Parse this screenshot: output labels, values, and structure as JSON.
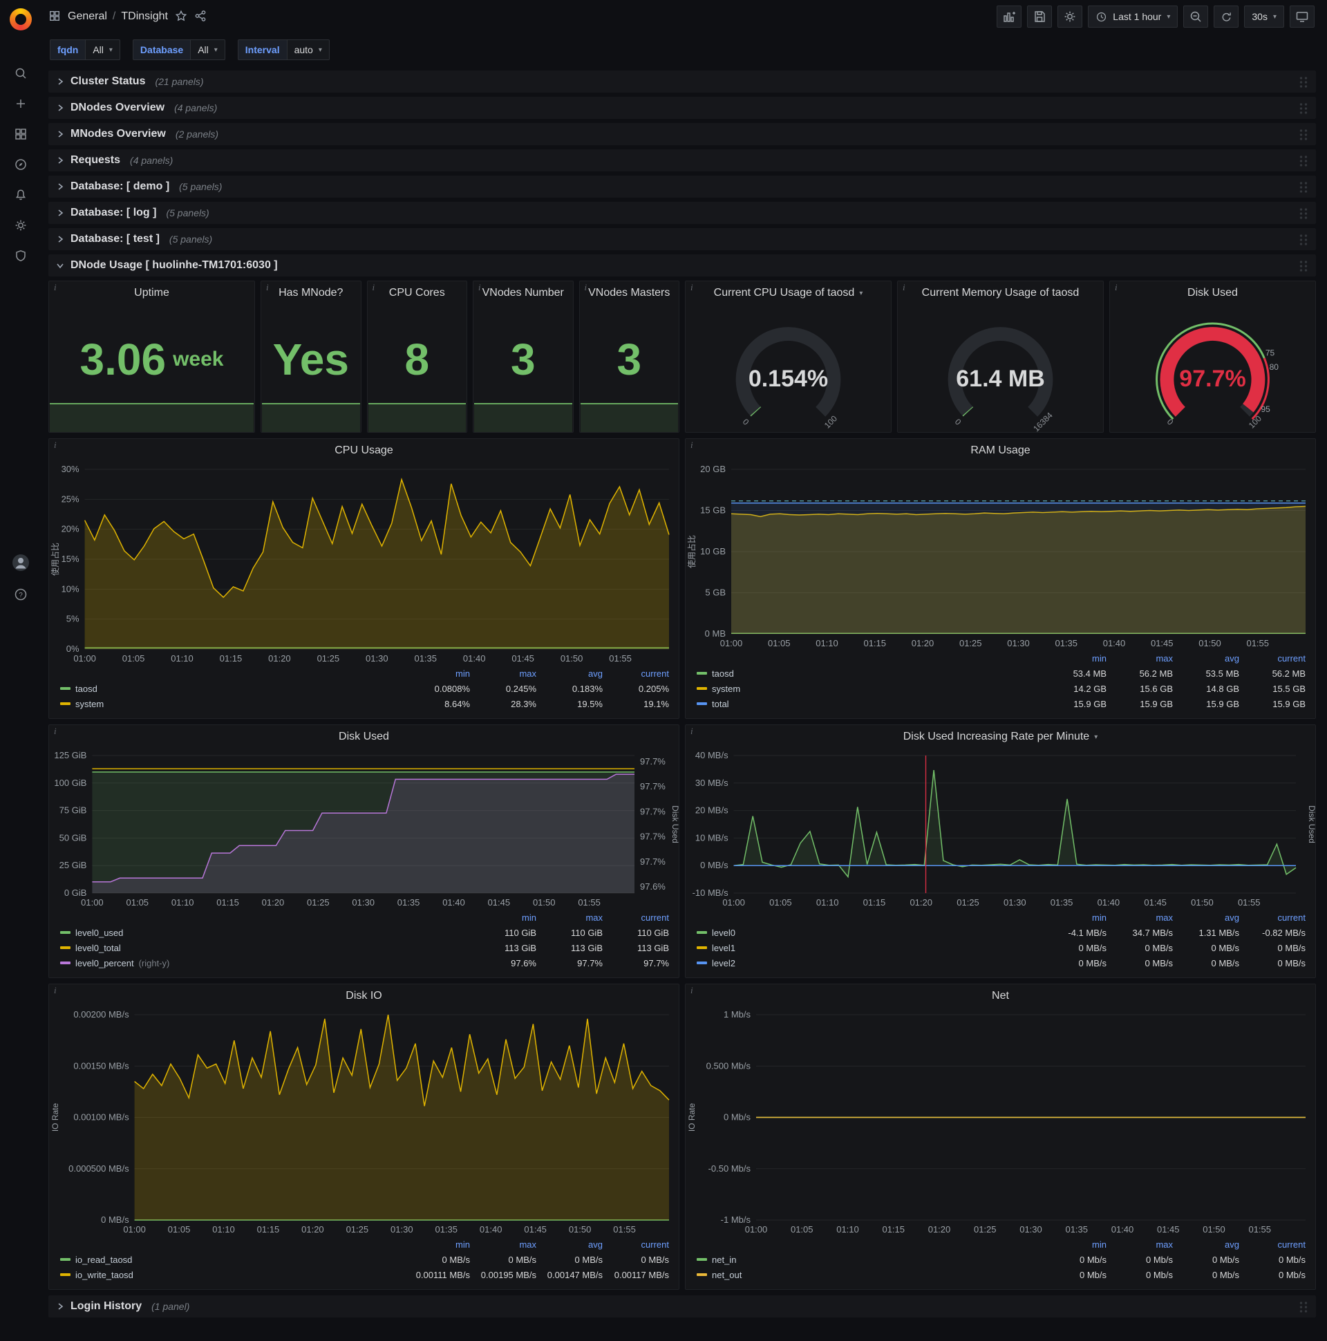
{
  "colors": {
    "green": "#73bf69",
    "yellow": "#e0b400",
    "blue": "#5794f2",
    "purple": "#b877d9",
    "red": "#e02f44",
    "orange": "#eab839",
    "cyan": "#6ed0e0"
  },
  "topnav": {
    "breadcrumb": {
      "section": "General",
      "separator": "/",
      "title": "TDinsight"
    },
    "time_range": "Last 1 hour",
    "refresh": "30s"
  },
  "variables": [
    {
      "label": "fqdn",
      "value": "All"
    },
    {
      "label": "Database",
      "value": "All"
    },
    {
      "label": "Interval",
      "value": "auto"
    }
  ],
  "rows_top": [
    {
      "title": "Cluster Status",
      "count": "(21 panels)"
    },
    {
      "title": "DNodes Overview",
      "count": "(4 panels)"
    },
    {
      "title": "MNodes Overview",
      "count": "(2 panels)"
    },
    {
      "title": "Requests",
      "count": "(4 panels)"
    },
    {
      "title": "Database: [ demo ]",
      "count": "(5 panels)"
    },
    {
      "title": "Database: [ log ]",
      "count": "(5 panels)"
    },
    {
      "title": "Database: [ test ]",
      "count": "(5 panels)"
    }
  ],
  "dnode_row": {
    "title": "DNode Usage [ huolinhe-TM1701:6030 ]"
  },
  "bottom_row": {
    "title": "Login History",
    "count": "(1 panel)"
  },
  "stats": [
    {
      "title": "Uptime",
      "value": "3.06",
      "suffix": "week"
    },
    {
      "title": "Has MNode?",
      "value": "Yes",
      "suffix": ""
    },
    {
      "title": "CPU Cores",
      "value": "8",
      "suffix": ""
    },
    {
      "title": "VNodes Number",
      "value": "3",
      "suffix": ""
    },
    {
      "title": "VNodes Masters",
      "value": "3",
      "suffix": ""
    }
  ],
  "gauges": [
    {
      "title": "Current CPU Usage of taosd",
      "caret": true,
      "value": "0.154%",
      "value_color": "#d8d9da",
      "fraction": 0.00154,
      "arc_color": "#73bf69",
      "min_label": "0",
      "max_label": "100"
    },
    {
      "title": "Current Memory Usage of taosd",
      "caret": false,
      "value": "61.4 MB",
      "value_color": "#d8d9da",
      "fraction": 0.0037,
      "arc_color": "#73bf69",
      "min_label": "0",
      "max_label": "16384"
    },
    {
      "title": "Disk Used",
      "caret": false,
      "value": "97.7%",
      "value_color": "#e02f44",
      "fraction": 0.977,
      "arc_color": "#e02f44",
      "min_label": "0",
      "max_label": "100",
      "ring": [
        {
          "from": 0,
          "to": 0.75,
          "color": "#73bf69"
        },
        {
          "from": 0.75,
          "to": 1,
          "color": "#e02f44"
        }
      ],
      "thresholds": [
        {
          "f": 0.75,
          "label": "75"
        },
        {
          "f": 0.8,
          "label": "80"
        },
        {
          "f": 0.95,
          "label": "95"
        }
      ]
    }
  ],
  "time_axis": {
    "minutes": 60,
    "step": 5,
    "ticks": [
      "01:00",
      "01:05",
      "01:10",
      "01:15",
      "01:20",
      "01:25",
      "01:30",
      "01:35",
      "01:40",
      "01:45",
      "01:50",
      "01:55"
    ]
  },
  "chart_data": [
    {
      "type": "line",
      "title": "CPU Usage",
      "ylabel": "使用占比",
      "ylim": [
        0,
        30
      ],
      "yticks": [
        {
          "v": 0,
          "label": "0%"
        },
        {
          "v": 5,
          "label": "5%"
        },
        {
          "v": 10,
          "label": "10%"
        },
        {
          "v": 15,
          "label": "15%"
        },
        {
          "v": 20,
          "label": "20%"
        },
        {
          "v": 25,
          "label": "25%"
        },
        {
          "v": 30,
          "label": "30%"
        }
      ],
      "series": [
        {
          "name": "taosd",
          "color": "#73bf69",
          "const": 0.2,
          "fill": 0.12
        },
        {
          "name": "system",
          "color": "#e0b400",
          "fill": 0.22,
          "values": [
            21.5,
            18.2,
            22.4,
            19.8,
            16.4,
            14.9,
            17.2,
            20.1,
            21.3,
            19.6,
            18.4,
            19.2,
            14.8,
            10.2,
            8.64,
            10.4,
            9.7,
            13.5,
            16.2,
            24.6,
            20.3,
            17.8,
            16.9,
            25.2,
            21.4,
            17.6,
            23.8,
            19.3,
            24.2,
            20.6,
            17.2,
            21.0,
            28.3,
            23.6,
            18.1,
            21.4,
            15.8,
            27.6,
            22.3,
            18.7,
            21.2,
            19.4,
            23.1,
            17.8,
            16.2,
            13.9,
            18.6,
            23.4,
            20.2,
            25.8,
            17.3,
            21.6,
            19.2,
            24.3,
            27.1,
            22.4,
            26.6,
            20.8,
            24.4,
            19.1
          ]
        }
      ],
      "legend": {
        "cols": [
          "min",
          "max",
          "avg",
          "current"
        ],
        "rows": [
          {
            "name": "taosd",
            "color": "#73bf69",
            "vals": [
              "0.0808%",
              "0.245%",
              "0.183%",
              "0.205%"
            ]
          },
          {
            "name": "system",
            "color": "#e0b400",
            "vals": [
              "8.64%",
              "28.3%",
              "19.5%",
              "19.1%"
            ]
          }
        ]
      }
    },
    {
      "type": "line",
      "title": "RAM Usage",
      "ylabel": "使用占比",
      "ylim": [
        0,
        20
      ],
      "yticks": [
        {
          "v": 0,
          "label": "0 MB"
        },
        {
          "v": 5,
          "label": "5 GB"
        },
        {
          "v": 10,
          "label": "10 GB"
        },
        {
          "v": 15,
          "label": "15 GB"
        },
        {
          "v": 20,
          "label": "20 GB"
        }
      ],
      "series": [
        {
          "name": "taosd",
          "color": "#73bf69",
          "const": 0.055,
          "fill": 0.12
        },
        {
          "name": "system",
          "color": "#e0b400",
          "fill": 0.22,
          "values": [
            14.6,
            14.55,
            14.5,
            14.25,
            14.55,
            14.6,
            14.5,
            14.45,
            14.5,
            14.55,
            14.5,
            14.6,
            14.55,
            14.5,
            14.6,
            14.65,
            14.6,
            14.55,
            14.6,
            14.5,
            14.55,
            14.6,
            14.65,
            14.6,
            14.55,
            14.6,
            14.7,
            14.65,
            14.6,
            14.7,
            14.75,
            14.8,
            14.75,
            14.8,
            14.85,
            14.8,
            14.85,
            14.9,
            14.85,
            14.9,
            14.95,
            14.9,
            14.95,
            15.0,
            14.95,
            15.0,
            15.05,
            15.0,
            15.05,
            15.1,
            15.05,
            15.1,
            15.15,
            15.1,
            15.2,
            15.25,
            15.3,
            15.35,
            15.45,
            15.5
          ]
        },
        {
          "name": "total",
          "color": "#5794f2",
          "const": 15.9,
          "fill": 0.1
        },
        {
          "name": "",
          "color": "#6ed0e0",
          "const": 16.15,
          "dash": true,
          "width": 1
        }
      ],
      "legend": {
        "cols": [
          "min",
          "max",
          "avg",
          "current"
        ],
        "rows": [
          {
            "name": "taosd",
            "color": "#73bf69",
            "vals": [
              "53.4 MB",
              "56.2 MB",
              "53.5 MB",
              "56.2 MB"
            ]
          },
          {
            "name": "system",
            "color": "#e0b400",
            "vals": [
              "14.2 GB",
              "15.6 GB",
              "14.8 GB",
              "15.5 GB"
            ]
          },
          {
            "name": "total",
            "color": "#5794f2",
            "vals": [
              "15.9 GB",
              "15.9 GB",
              "15.9 GB",
              "15.9 GB"
            ]
          }
        ]
      }
    },
    {
      "type": "line",
      "title": "Disk Used",
      "ylim": [
        0,
        125
      ],
      "yticks": [
        {
          "v": 0,
          "label": "0 GiB"
        },
        {
          "v": 25,
          "label": "25 GiB"
        },
        {
          "v": 50,
          "label": "50 GiB"
        },
        {
          "v": 75,
          "label": "75 GiB"
        },
        {
          "v": 100,
          "label": "100 GiB"
        },
        {
          "v": 125,
          "label": "125 GiB"
        }
      ],
      "right": {
        "label": "Disk Used",
        "ylim": [
          97.595,
          97.705
        ],
        "ticks": [
          {
            "v": 97.6,
            "label": "97.6%"
          },
          {
            "v": 97.62,
            "label": "97.7%"
          },
          {
            "v": 97.64,
            "label": "97.7%"
          },
          {
            "v": 97.66,
            "label": "97.7%"
          },
          {
            "v": 97.68,
            "label": "97.7%"
          },
          {
            "v": 97.7,
            "label": "97.7%"
          }
        ]
      },
      "series": [
        {
          "name": "level0_used",
          "color": "#73bf69",
          "const": 110,
          "fill": 0.15
        },
        {
          "name": "level0_total",
          "color": "#e0b400",
          "const": 113
        },
        {
          "name": "level0_percent",
          "color": "#b877d9",
          "axis": "right",
          "fill": 0.15,
          "values": [
            97.604,
            97.604,
            97.604,
            97.607,
            97.607,
            97.607,
            97.607,
            97.607,
            97.607,
            97.607,
            97.607,
            97.607,
            97.607,
            97.627,
            97.627,
            97.627,
            97.633,
            97.633,
            97.633,
            97.633,
            97.633,
            97.645,
            97.645,
            97.645,
            97.645,
            97.659,
            97.659,
            97.659,
            97.659,
            97.659,
            97.659,
            97.659,
            97.659,
            97.686,
            97.686,
            97.686,
            97.686,
            97.686,
            97.686,
            97.686,
            97.686,
            97.686,
            97.686,
            97.686,
            97.686,
            97.686,
            97.686,
            97.686,
            97.686,
            97.686,
            97.686,
            97.686,
            97.686,
            97.686,
            97.686,
            97.686,
            97.686,
            97.69,
            97.69,
            97.69
          ]
        }
      ],
      "legend": {
        "cols": [
          "min",
          "max",
          "current"
        ],
        "rows": [
          {
            "name": "level0_used",
            "color": "#73bf69",
            "vals": [
              "110 GiB",
              "110 GiB",
              "110 GiB"
            ]
          },
          {
            "name": "level0_total",
            "color": "#e0b400",
            "vals": [
              "113 GiB",
              "113 GiB",
              "113 GiB"
            ]
          },
          {
            "name": "level0_percent",
            "color": "#b877d9",
            "note": "(right-y)",
            "vals": [
              "97.6%",
              "97.7%",
              "97.7%"
            ]
          }
        ]
      }
    },
    {
      "type": "line",
      "title": "Disk Used Increasing Rate per Minute",
      "title_caret": true,
      "ylim": [
        -10,
        40
      ],
      "yticks": [
        {
          "v": -10,
          "label": "-10 MB/s"
        },
        {
          "v": 0,
          "label": "0 MB/s"
        },
        {
          "v": 10,
          "label": "10 MB/s"
        },
        {
          "v": 20,
          "label": "20 MB/s"
        },
        {
          "v": 30,
          "label": "30 MB/s"
        },
        {
          "v": 40,
          "label": "40 MB/s"
        }
      ],
      "right": {
        "label": "Disk Used"
      },
      "vline": {
        "m": 20.5,
        "color": "#e02f44"
      },
      "series": [
        {
          "name": "level0",
          "color": "#73bf69",
          "fill": 0.12,
          "values": [
            0,
            0.4,
            18,
            1.2,
            0.2,
            -0.6,
            0.3,
            8.2,
            12.4,
            0.6,
            0.1,
            0.2,
            -4.1,
            21.3,
            0.4,
            12.1,
            0.3,
            0.1,
            0.2,
            0.4,
            0.1,
            34.7,
            1.8,
            0.3,
            -0.4,
            0.2,
            0.1,
            0.3,
            0.5,
            0.2,
            2.1,
            0.3,
            0.1,
            0.4,
            0.2,
            24.2,
            0.5,
            0.1,
            0.3,
            0.2,
            0.1,
            0.4,
            0.2,
            0.3,
            0.1,
            0.2,
            0.4,
            0.1,
            0.3,
            0.2,
            0.1,
            0.3,
            0.2,
            0.4,
            0.1,
            0.2,
            0.3,
            7.8,
            -3.2,
            -0.8
          ]
        },
        {
          "name": "level1",
          "color": "#e0b400",
          "const": 0
        },
        {
          "name": "level2",
          "color": "#5794f2",
          "const": 0
        }
      ],
      "legend": {
        "cols": [
          "min",
          "max",
          "avg",
          "current"
        ],
        "rows": [
          {
            "name": "level0",
            "color": "#73bf69",
            "vals": [
              "-4.1 MB/s",
              "34.7 MB/s",
              "1.31 MB/s",
              "-0.82 MB/s"
            ]
          },
          {
            "name": "level1",
            "color": "#e0b400",
            "vals": [
              "0 MB/s",
              "0 MB/s",
              "0 MB/s",
              "0 MB/s"
            ]
          },
          {
            "name": "level2",
            "color": "#5794f2",
            "vals": [
              "0 MB/s",
              "0 MB/s",
              "0 MB/s",
              "0 MB/s"
            ]
          }
        ]
      }
    },
    {
      "type": "line",
      "title": "Disk IO",
      "ylabel": "IO Rate",
      "ylim": [
        0,
        0.002
      ],
      "yticks": [
        {
          "v": 0,
          "label": "0 MB/s"
        },
        {
          "v": 0.0005,
          "label": "0.000500 MB/s"
        },
        {
          "v": 0.001,
          "label": "0.00100 MB/s"
        },
        {
          "v": 0.0015,
          "label": "0.00150 MB/s"
        },
        {
          "v": 0.002,
          "label": "0.00200 MB/s"
        }
      ],
      "series": [
        {
          "name": "io_read_taosd",
          "color": "#73bf69",
          "const": 0
        },
        {
          "name": "io_write_taosd",
          "color": "#e0b400",
          "fill": 0.2,
          "values": [
            0.00135,
            0.00128,
            0.00142,
            0.00131,
            0.00152,
            0.00138,
            0.00119,
            0.00161,
            0.00148,
            0.00152,
            0.00133,
            0.00175,
            0.00128,
            0.00158,
            0.00139,
            0.00184,
            0.00122,
            0.00147,
            0.00168,
            0.00132,
            0.00151,
            0.00196,
            0.00124,
            0.00158,
            0.00141,
            0.00186,
            0.00129,
            0.00152,
            0.002,
            0.00136,
            0.00148,
            0.00172,
            0.00111,
            0.00155,
            0.00139,
            0.00168,
            0.00125,
            0.00181,
            0.00143,
            0.00157,
            0.00122,
            0.00176,
            0.00138,
            0.00149,
            0.00191,
            0.00126,
            0.00154,
            0.00137,
            0.0017,
            0.00129,
            0.00196,
            0.00123,
            0.00158,
            0.00134,
            0.00172,
            0.00128,
            0.00145,
            0.00131,
            0.00126,
            0.00117
          ]
        }
      ],
      "legend": {
        "cols": [
          "min",
          "max",
          "avg",
          "current"
        ],
        "rows": [
          {
            "name": "io_read_taosd",
            "color": "#73bf69",
            "vals": [
              "0 MB/s",
              "0 MB/s",
              "0 MB/s",
              "0 MB/s"
            ]
          },
          {
            "name": "io_write_taosd",
            "color": "#e0b400",
            "vals": [
              "0.00111 MB/s",
              "0.00195 MB/s",
              "0.00147 MB/s",
              "0.00117 MB/s"
            ]
          }
        ]
      }
    },
    {
      "type": "line",
      "title": "Net",
      "ylabel": "IO Rate",
      "ylim": [
        -1,
        1
      ],
      "yticks": [
        {
          "v": -1,
          "label": "-1 Mb/s"
        },
        {
          "v": -0.5,
          "label": "-0.50 Mb/s"
        },
        {
          "v": 0,
          "label": "0 Mb/s"
        },
        {
          "v": 0.5,
          "label": "0.500 Mb/s"
        },
        {
          "v": 1,
          "label": "1 Mb/s"
        }
      ],
      "series": [
        {
          "name": "net_in",
          "color": "#73bf69",
          "const": 0
        },
        {
          "name": "net_out",
          "color": "#eab839",
          "const": 0
        }
      ],
      "legend": {
        "cols": [
          "min",
          "max",
          "avg",
          "current"
        ],
        "rows": [
          {
            "name": "net_in",
            "color": "#73bf69",
            "vals": [
              "0 Mb/s",
              "0 Mb/s",
              "0 Mb/s",
              "0 Mb/s"
            ]
          },
          {
            "name": "net_out",
            "color": "#eab839",
            "vals": [
              "0 Mb/s",
              "0 Mb/s",
              "0 Mb/s",
              "0 Mb/s"
            ]
          }
        ]
      }
    }
  ]
}
